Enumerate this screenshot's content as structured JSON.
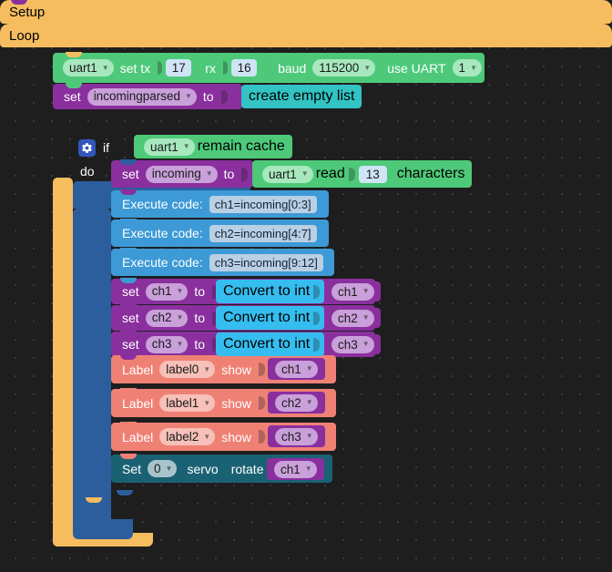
{
  "workspace": {
    "name": "blockly-workspace",
    "background": "#1e1e1e",
    "grid_dot_color": "#3a3a3a",
    "grid_spacing": 20
  },
  "colors": {
    "event_hat": "#f5bd5f",
    "uart_green": "#4ec97a",
    "variable_purple": "#8a2f9e",
    "list_teal": "#33c3c3",
    "code_blue": "#3d9ad6",
    "convert_cyan": "#35bdef",
    "display_salmon": "#ef8174",
    "servo_darkteal": "#1a6273",
    "control_blue": "#2c5e9e"
  },
  "setup": {
    "hat_label": "Setup",
    "uart_init": {
      "port": "uart1",
      "set_tx_label": "set tx",
      "tx_value": "17",
      "rx_label": "rx",
      "rx_value": "16",
      "baud_label": "baud",
      "baud_value": "115200",
      "use_uart_label": "use UART",
      "use_uart_value": "1"
    },
    "set_var": {
      "set_label": "set",
      "variable": "incomingparsed",
      "to_label": "to",
      "value_label": "create empty list"
    }
  },
  "loop": {
    "hat_label": "Loop",
    "if_block": {
      "gear_icon": "gear-icon",
      "if_label": "if",
      "do_label": "do",
      "condition": {
        "port": "uart1",
        "text": "remain cache"
      }
    },
    "statements": [
      {
        "kind": "set-variable-read",
        "set_label": "set",
        "variable": "incoming",
        "to_label": "to",
        "value": {
          "port": "uart1",
          "read_label": "read",
          "count": "13",
          "characters_label": "characters"
        }
      },
      {
        "kind": "execute-code",
        "label": "Execute code:",
        "code": "ch1=incoming[0:3]"
      },
      {
        "kind": "execute-code",
        "label": "Execute code:",
        "code": "ch2=incoming[4:7]"
      },
      {
        "kind": "execute-code",
        "label": "Execute code:",
        "code": "ch3=incoming[9:12]"
      },
      {
        "kind": "set-convert",
        "set_label": "set",
        "variable": "ch1",
        "to_label": "to",
        "convert_label": "Convert to int",
        "arg": "ch1"
      },
      {
        "kind": "set-convert",
        "set_label": "set",
        "variable": "ch2",
        "to_label": "to",
        "convert_label": "Convert to int",
        "arg": "ch2"
      },
      {
        "kind": "set-convert",
        "set_label": "set",
        "variable": "ch3",
        "to_label": "to",
        "convert_label": "Convert to int",
        "arg": "ch3"
      },
      {
        "kind": "label-show",
        "label_word": "Label",
        "target": "label0",
        "show_label": "show",
        "arg": "ch1"
      },
      {
        "kind": "label-show",
        "label_word": "Label",
        "target": "label1",
        "show_label": "show",
        "arg": "ch2"
      },
      {
        "kind": "label-show",
        "label_word": "Label",
        "target": "label2",
        "show_label": "show",
        "arg": "ch3"
      },
      {
        "kind": "servo-rotate",
        "set_label": "Set",
        "index": "0",
        "servo_label": "servo",
        "rotate_label": "rotate",
        "arg": "ch1"
      }
    ]
  }
}
